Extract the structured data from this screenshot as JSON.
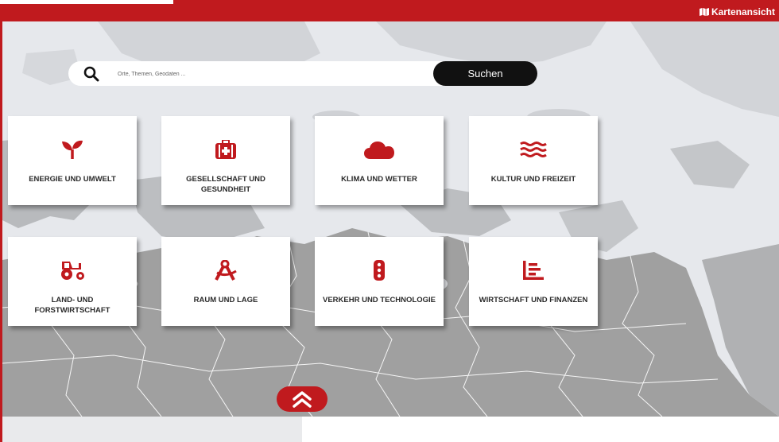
{
  "header": {
    "map_view_label": "Kartenansicht"
  },
  "search": {
    "placeholder": "Orte, Themen, Geodaten ...",
    "button_label": "Suchen"
  },
  "categories": [
    {
      "label": "ENERGIE UND UMWELT",
      "icon": "seedling-icon"
    },
    {
      "label": "GESELLSCHAFT UND GESUNDHEIT",
      "icon": "medkit-icon"
    },
    {
      "label": "KLIMA UND WETTER",
      "icon": "cloud-icon"
    },
    {
      "label": "KULTUR UND FREIZEIT",
      "icon": "water-icon"
    },
    {
      "label": "LAND- UND FORSTWIRTSCHAFT",
      "icon": "tractor-icon"
    },
    {
      "label": "RAUM UND LAGE",
      "icon": "drafting-compass-icon"
    },
    {
      "label": "VERKEHR UND TECHNOLOGIE",
      "icon": "traffic-light-icon"
    },
    {
      "label": "WIRTSCHAFT UND FINANZEN",
      "icon": "bar-chart-icon"
    }
  ],
  "colors": {
    "accent": "#c01a1e",
    "button_dark": "#111111",
    "map_land": "#a0a0a0",
    "map_water": "#e6e8ec"
  }
}
